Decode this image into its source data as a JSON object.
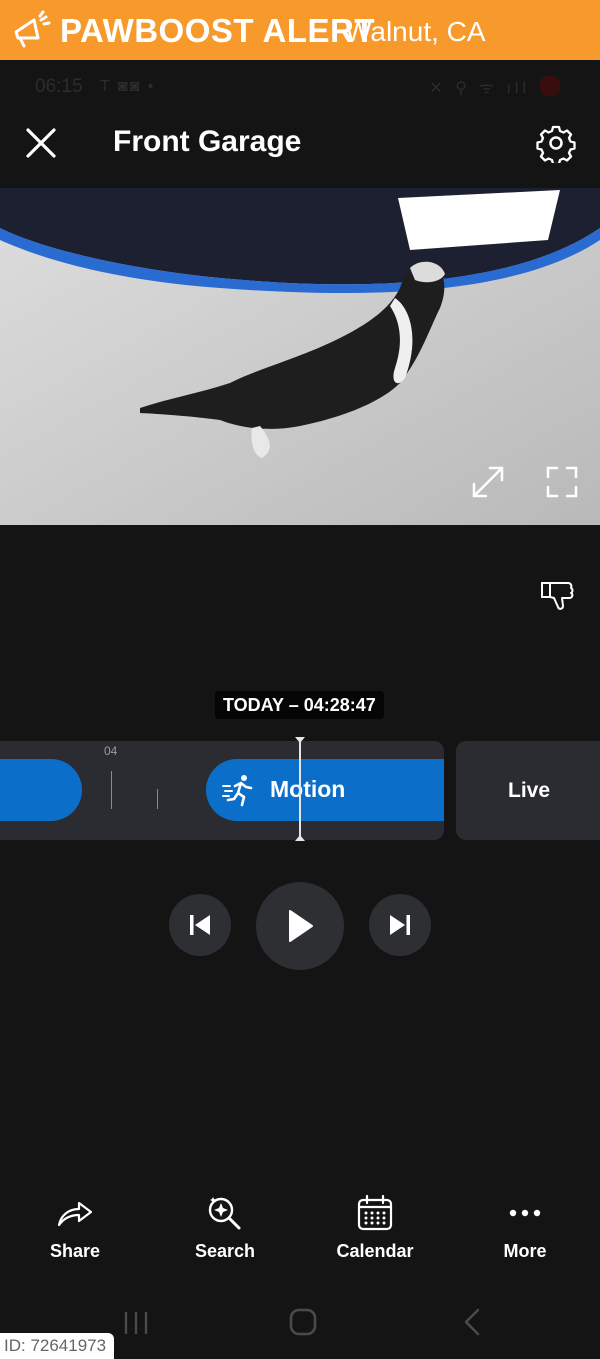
{
  "banner": {
    "title": "PAWBOOST ALERT",
    "location": "Walnut, CA",
    "color": "#f79a2b",
    "icon": "megaphone-icon"
  },
  "status_bar": {
    "time": "06:15",
    "left_icons": "T ◙◙ •",
    "right_icons": "✕ ⚲ ᯤ ıll"
  },
  "header": {
    "title": "Front Garage",
    "close_icon": "close-icon",
    "settings_icon": "gear-icon"
  },
  "video": {
    "expand_icon": "expand-arrows-icon",
    "fullscreen_icon": "fullscreen-icon"
  },
  "feedback_icon": "thumbs-down-icon",
  "timeline": {
    "timestamp": "TODAY – 04:28:47",
    "tick_label": "04",
    "event_label": "Motion",
    "event_icon": "running-person-icon",
    "event_color": "#0b6fc9",
    "live_label": "Live"
  },
  "playback": {
    "previous_icon": "skip-previous-icon",
    "play_icon": "play-icon",
    "next_icon": "skip-next-icon"
  },
  "bottom_nav": {
    "items": [
      {
        "label": "Share",
        "icon": "share-icon"
      },
      {
        "label": "Search",
        "icon": "search-sparkle-icon"
      },
      {
        "label": "Calendar",
        "icon": "calendar-icon"
      },
      {
        "label": "More",
        "icon": "more-dots-icon"
      }
    ]
  },
  "watermark": {
    "id": "ID: 72641973"
  }
}
